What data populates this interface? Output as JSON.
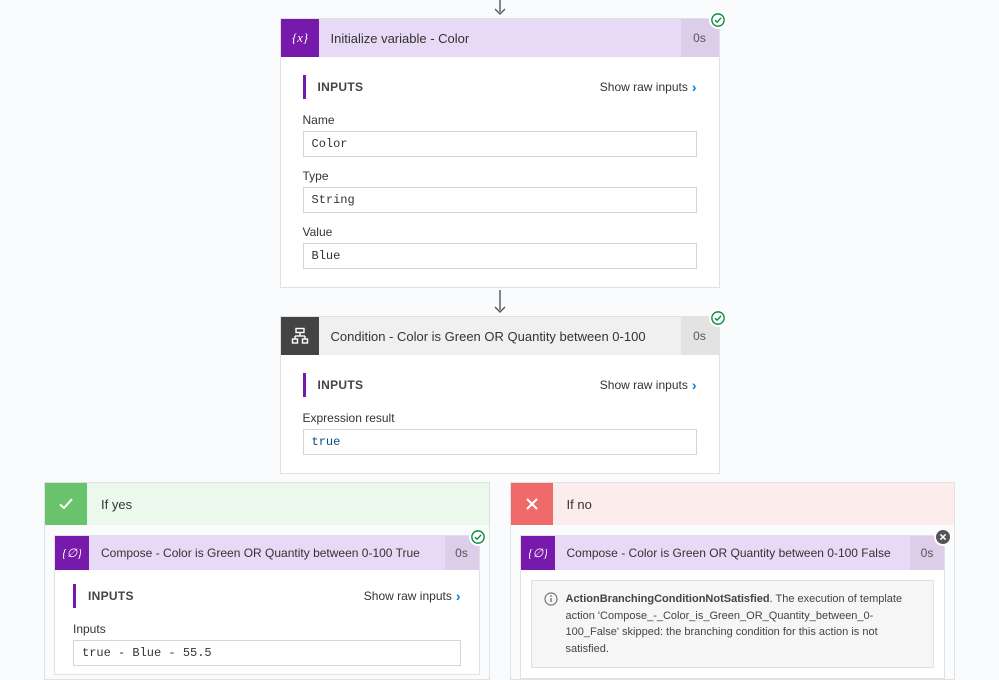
{
  "actions": {
    "init": {
      "title": "Initialize variable - Color",
      "duration": "0s",
      "inputsLabel": "INPUTS",
      "rawLink": "Show raw inputs",
      "fields": {
        "nameLabel": "Name",
        "nameValue": "Color",
        "typeLabel": "Type",
        "typeValue": "String",
        "valueLabel": "Value",
        "valueValue": "Blue"
      }
    },
    "condition": {
      "title": "Condition - Color is Green OR Quantity between 0-100",
      "duration": "0s",
      "inputsLabel": "INPUTS",
      "rawLink": "Show raw inputs",
      "exprLabel": "Expression result",
      "exprValue": "true"
    }
  },
  "branches": {
    "yes": {
      "label": "If yes",
      "compose": {
        "title": "Compose - Color is Green OR Quantity between 0-100 True",
        "duration": "0s",
        "inputsLabel": "INPUTS",
        "rawLink": "Show raw inputs",
        "fieldLabel": "Inputs",
        "fieldValue": "true - Blue - 55.5"
      }
    },
    "no": {
      "label": "If no",
      "compose": {
        "title": "Compose - Color is Green OR Quantity between 0-100 False",
        "duration": "0s"
      },
      "skipped": {
        "code": "ActionBranchingConditionNotSatisfied",
        "text": ". The execution of template action 'Compose_-_Color_is_Green_OR_Quantity_between_0-100_False' skipped: the branching condition for this action is not satisfied."
      }
    }
  }
}
